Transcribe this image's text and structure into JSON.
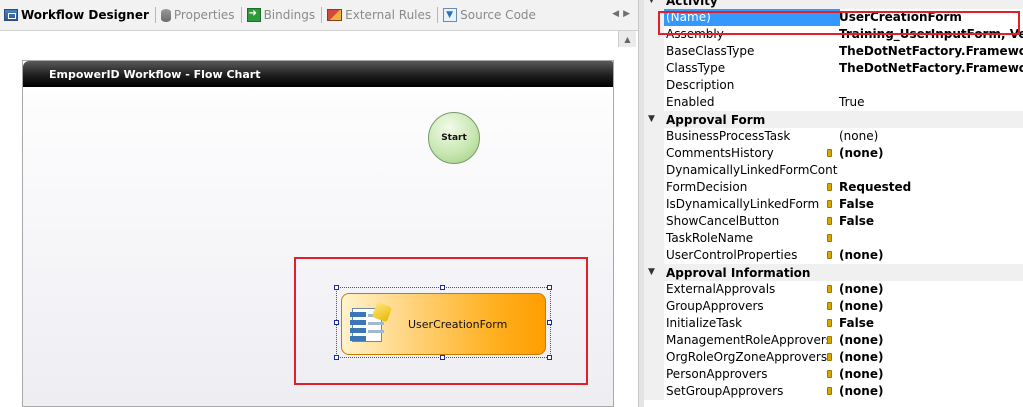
{
  "tabs": [
    {
      "label": "Workflow Designer",
      "icon": "workflow-icon",
      "active": true
    },
    {
      "label": "Properties",
      "icon": "database-icon",
      "active": false
    },
    {
      "label": "Bindings",
      "icon": "bindings-icon",
      "active": false
    },
    {
      "label": "External Rules",
      "icon": "rules-icon",
      "active": false
    },
    {
      "label": "Source Code",
      "icon": "source-code-icon",
      "active": false
    }
  ],
  "flowchart": {
    "title": "EmpowerID Workflow - Flow Chart",
    "start_label": "Start",
    "activity_label": "UserCreationForm"
  },
  "property_grid": {
    "categories": [
      {
        "name": "Activity",
        "rows": [
          {
            "name": "(Name)",
            "value": "UserCreationForm",
            "bold": true,
            "lock": false,
            "selected": true
          },
          {
            "name": "Assembly",
            "value": "Training_UserInputForm, Ve",
            "bold": true,
            "lock": false
          },
          {
            "name": "BaseClassType",
            "value": "TheDotNetFactory.Framewo",
            "bold": true,
            "lock": false
          },
          {
            "name": "ClassType",
            "value": "TheDotNetFactory.Framewo",
            "bold": true,
            "lock": false
          },
          {
            "name": "Description",
            "value": "",
            "bold": false,
            "lock": false
          },
          {
            "name": "Enabled",
            "value": "True",
            "bold": false,
            "lock": false
          }
        ]
      },
      {
        "name": "Approval Form",
        "rows": [
          {
            "name": "BusinessProcessTask",
            "value": "(none)",
            "bold": false,
            "lock": false
          },
          {
            "name": "CommentsHistory",
            "value": "(none)",
            "bold": true,
            "lock": true
          },
          {
            "name": "DynamicallyLinkedFormCont",
            "value": "",
            "bold": false,
            "lock": false
          },
          {
            "name": "FormDecision",
            "value": "Requested",
            "bold": true,
            "lock": true
          },
          {
            "name": "IsDynamicallyLinkedForm",
            "value": "False",
            "bold": true,
            "lock": true
          },
          {
            "name": "ShowCancelButton",
            "value": "False",
            "bold": true,
            "lock": true
          },
          {
            "name": "TaskRoleName",
            "value": "",
            "bold": false,
            "lock": true
          },
          {
            "name": "UserControlProperties",
            "value": "(none)",
            "bold": true,
            "lock": true
          }
        ]
      },
      {
        "name": "Approval Information",
        "rows": [
          {
            "name": "ExternalApprovals",
            "value": "(none)",
            "bold": true,
            "lock": true
          },
          {
            "name": "GroupApprovers",
            "value": "(none)",
            "bold": true,
            "lock": true
          },
          {
            "name": "InitializeTask",
            "value": "False",
            "bold": true,
            "lock": true
          },
          {
            "name": "ManagementRoleApprovers",
            "value": "(none)",
            "bold": true,
            "lock": true
          },
          {
            "name": "OrgRoleOrgZoneApprovers",
            "value": "(none)",
            "bold": true,
            "lock": true
          },
          {
            "name": "PersonApprovers",
            "value": "(none)",
            "bold": true,
            "lock": true
          },
          {
            "name": "SetGroupApprovers",
            "value": "(none)",
            "bold": true,
            "lock": true
          }
        ]
      }
    ]
  },
  "colors": {
    "highlight_frame": "#e0202a",
    "selected_row": "#3399ff",
    "activity_gradient_end": "#ff9e00"
  }
}
